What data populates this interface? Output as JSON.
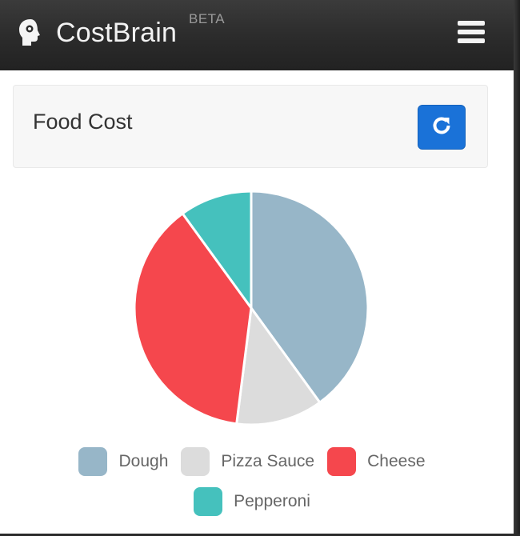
{
  "app": {
    "brand_name": "CostBrain",
    "beta_badge": "BETA"
  },
  "header": {
    "menu_icon": "hamburger-menu-icon",
    "brand_icon": "brain-head-icon"
  },
  "panel": {
    "title": "Food Cost",
    "refresh_icon": "refresh-icon",
    "refresh_color": "#1a72d8"
  },
  "chart_data": {
    "type": "pie",
    "title": "",
    "categories": [
      "Dough",
      "Pizza Sauce",
      "Cheese",
      "Pepperoni"
    ],
    "values": [
      40,
      12,
      38,
      10
    ],
    "colors": [
      "#97b6c8",
      "#dcdcdc",
      "#f5474d",
      "#45c1bd"
    ],
    "legend_position": "bottom"
  }
}
